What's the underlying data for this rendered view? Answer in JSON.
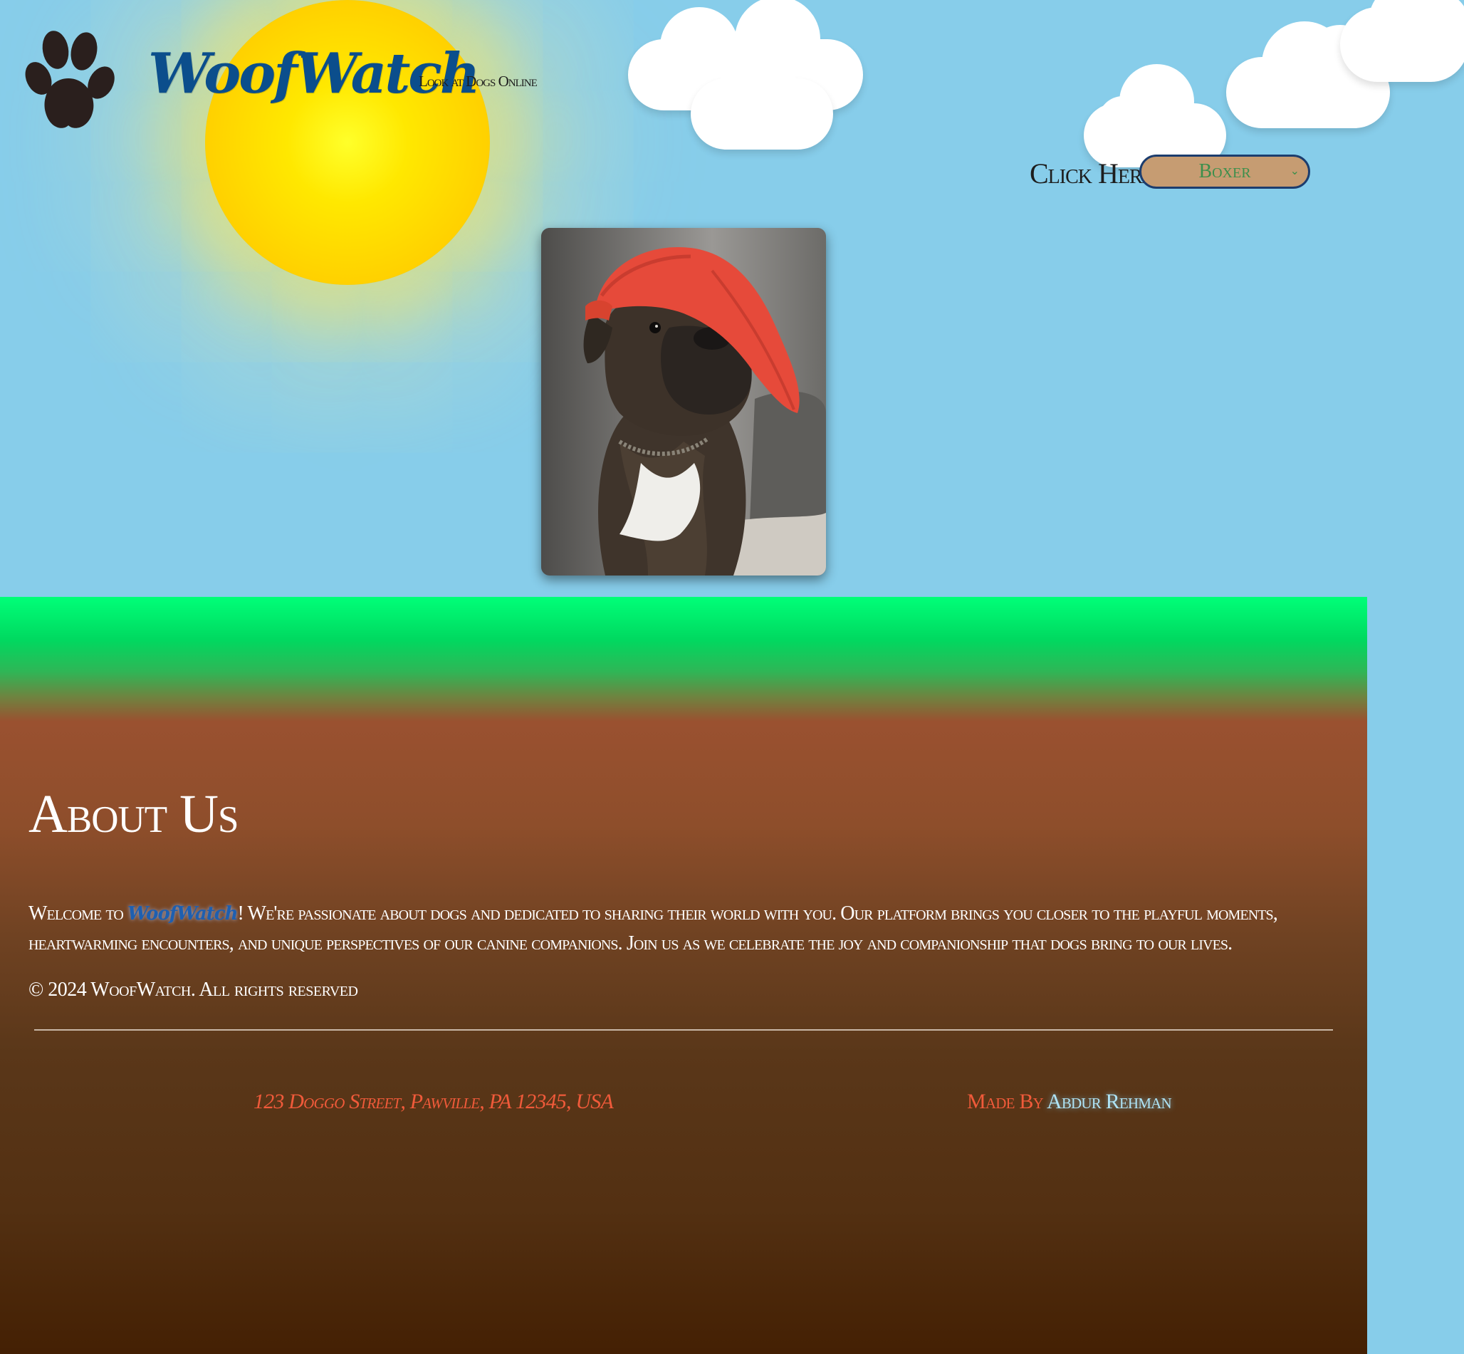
{
  "header": {
    "brand": "WoofWatch",
    "tagline": "Look at Dogs Online",
    "logo_icon": "paw-icon"
  },
  "breed_picker": {
    "label": "Click Here!",
    "selected": "Boxer",
    "icon": "chevron-down-icon"
  },
  "photo": {
    "alt": "Boxer dog wearing a red cap"
  },
  "about": {
    "title": "About Us",
    "intro_prefix": "Welcome to ",
    "intro_brand": "WoofWatch",
    "intro_body": "! We're passionate about dogs and dedicated to sharing their world with you. Our platform brings you closer to the playful moments, heartwarming encounters, and unique perspectives of our canine companions. Join us as we celebrate the joy and companionship that dogs bring to our lives."
  },
  "footer": {
    "copyright": "© 2024 WoofWatch. All rights reserved",
    "address": "123 Doggo Street, Pawville, PA 12345, USA",
    "made_by_prefix": "Made By ",
    "author": "Abdur Rehman"
  },
  "colors": {
    "sky": "#87cdea",
    "brand": "#0b4e8c",
    "grass": "#00ff78",
    "soil": "#442003",
    "accent_red": "#f05a3a",
    "select_bg": "#c69c72"
  }
}
